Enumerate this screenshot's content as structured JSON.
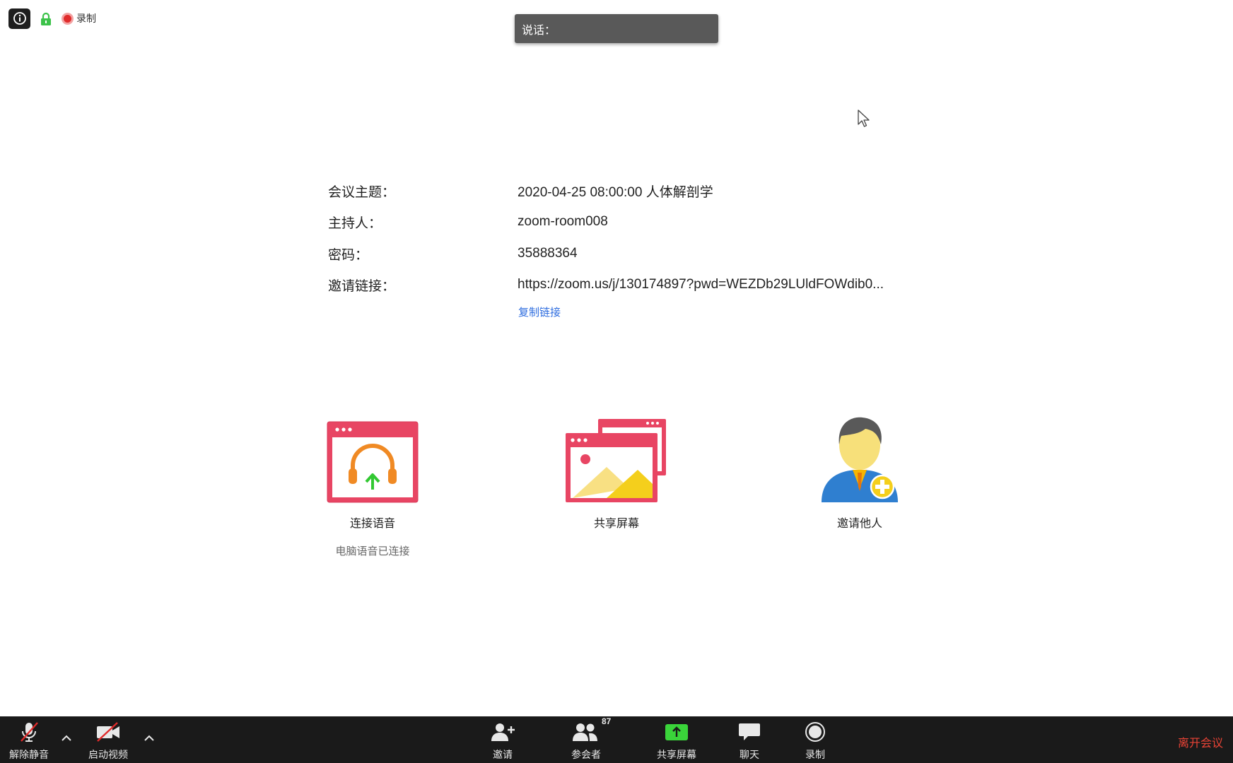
{
  "status": {
    "recording_label": "录制"
  },
  "speaking": {
    "label": "说话："
  },
  "meeting": {
    "rows": [
      {
        "label": "会议主题：",
        "value": "2020-04-25 08:00:00 人体解剖学"
      },
      {
        "label": "主持人：",
        "value": "zoom-room008"
      },
      {
        "label": "密码：",
        "value": "35888364"
      },
      {
        "label": "邀请链接：",
        "value": "https://zoom.us/j/130174897?pwd=WEZDb29LUldFOWdib0..."
      }
    ],
    "copy_link": "复制链接"
  },
  "tiles": {
    "audio": {
      "label": "连接语音",
      "sub": "电脑语音已连接"
    },
    "share": {
      "label": "共享屏幕"
    },
    "invite": {
      "label": "邀请他人"
    }
  },
  "toolbar": {
    "unmute": "解除静音",
    "start_video": "启动视频",
    "invite": "邀请",
    "participants": "参会者",
    "participants_count": "87",
    "share_screen": "共享屏幕",
    "chat": "聊天",
    "record": "录制",
    "leave": "离开会议"
  },
  "colors": {
    "accent_red": "#ea4335",
    "link_blue": "#2d6cdf",
    "share_green": "#3ad43a",
    "toolbar_bg": "#1a1a1a"
  }
}
